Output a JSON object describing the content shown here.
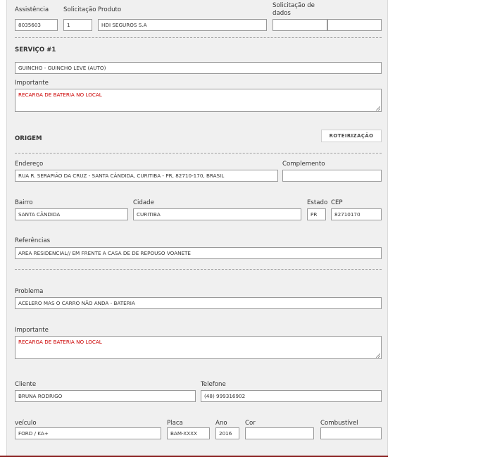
{
  "header": {
    "assistencia_label": "Assistência",
    "assistencia_value": "8035603",
    "solicitacao_label": "Solicitação",
    "solicitacao_value": "1",
    "produto_label": "Produto",
    "produto_value": "HDI SEGUROS S.A",
    "solicitacao_dados_label": "Solicitação de dados",
    "solicitacao_dados_value1": "",
    "solicitacao_dados_value2": ""
  },
  "servico": {
    "heading": "SERVIÇO #1",
    "tipo_value": "GUINCHO - GUINCHO LEVE (AUTO)",
    "importante_label": "Importante",
    "importante_value": "RECARGA DE BATERIA NO LOCAL"
  },
  "origem": {
    "heading": "ORIGEM",
    "roteirizacao_label": "ROTEIRIZAÇÃO",
    "endereco_label": "Endereço",
    "endereco_value": "RUA R. SERAPIÃO DA CRUZ - SANTA CÂNDIDA, CURITIBA - PR, 82710-170, BRASIL",
    "complemento_label": "Complemento",
    "complemento_value": "",
    "bairro_label": "Bairro",
    "bairro_value": "SANTA CÂNDIDA",
    "cidade_label": "Cidade",
    "cidade_value": "CURITIBA",
    "estado_label": "Estado",
    "estado_value": "PR",
    "cep_label": "CEP",
    "cep_value": "82710170",
    "referencias_label": "Referências",
    "referencias_value": "AREA RESIDENCIAL// EM FRENTE A CASA DE DE REPOUSO VOANETE"
  },
  "problema": {
    "problema_label": "Problema",
    "problema_value": "ACELERO MAS O CARRO NÃO ANDA - BATERIA",
    "importante_label": "Importante",
    "importante_value": "RECARGA DE BATERIA NO LOCAL"
  },
  "cliente": {
    "cliente_label": "Cliente",
    "cliente_value": "BRUNA RODRIGO",
    "telefone_label": "Telefone",
    "telefone_value": "(48) 999316902"
  },
  "veiculo": {
    "veiculo_label": "veículo",
    "veiculo_value": "FORD / KA+",
    "placa_label": "Placa",
    "placa_value": "BAM-XXXX",
    "ano_label": "Ano",
    "ano_value": "2016",
    "cor_label": "Cor",
    "cor_value": "",
    "combustivel_label": "Combustível",
    "combustivel_value": ""
  }
}
